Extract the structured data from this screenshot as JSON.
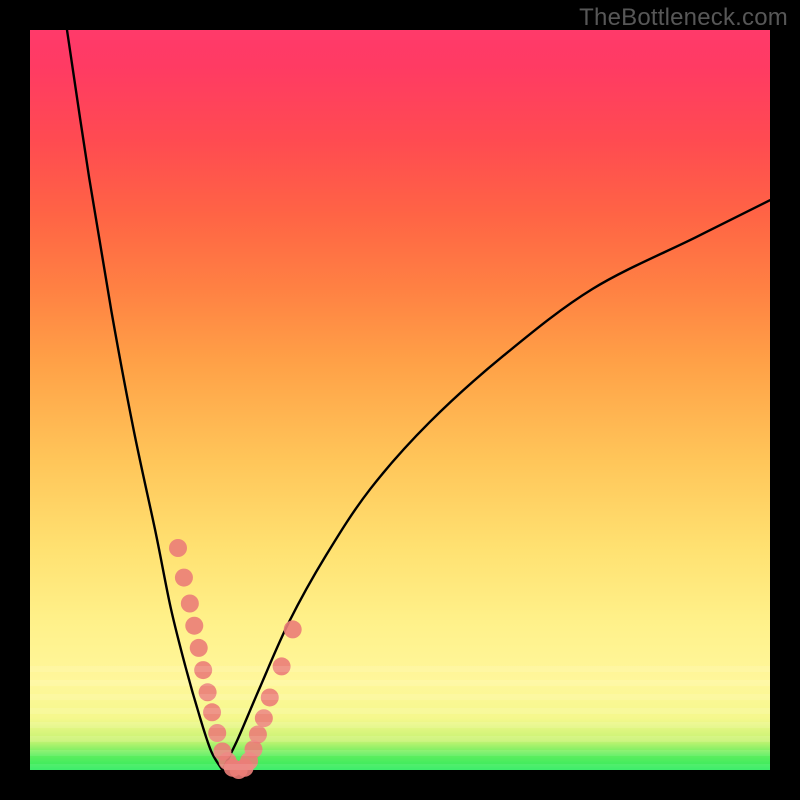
{
  "watermark": {
    "text": "TheBottleneck.com"
  },
  "chart_data": {
    "type": "line",
    "title": "",
    "xlabel": "",
    "ylabel": "",
    "xlim": [
      0,
      100
    ],
    "ylim": [
      0,
      100
    ],
    "minimum_x": 26,
    "series": [
      {
        "name": "bottleneck-curve-left",
        "x": [
          5,
          8,
          11,
          14,
          17,
          19,
          21,
          23,
          24.5,
          26
        ],
        "values": [
          100,
          80,
          62,
          46,
          32,
          22,
          14,
          7,
          2.5,
          0
        ]
      },
      {
        "name": "bottleneck-curve-right",
        "x": [
          26,
          28,
          31,
          35,
          40,
          46,
          54,
          64,
          76,
          90,
          100
        ],
        "values": [
          0,
          4,
          11,
          20,
          29,
          38,
          47,
          56,
          65,
          72,
          77
        ]
      }
    ],
    "scatter": {
      "name": "data-points",
      "color": "#eb7d78",
      "x": [
        20,
        20.8,
        21.6,
        22.2,
        22.8,
        23.4,
        24.0,
        24.6,
        25.3,
        26.0,
        26.7,
        27.4,
        28.2,
        29.0,
        29.6,
        30.2,
        30.8,
        31.6,
        32.4,
        34.0,
        35.5
      ],
      "values": [
        30,
        26,
        22.5,
        19.5,
        16.5,
        13.5,
        10.5,
        7.8,
        5.0,
        2.5,
        1.2,
        0.3,
        0.0,
        0.3,
        1.2,
        2.8,
        4.8,
        7.0,
        9.8,
        14.0,
        19.0
      ]
    },
    "gradient_stops": [
      {
        "pos": 0,
        "color": "#2eeb5d"
      },
      {
        "pos": 10,
        "color": "#fff79b"
      },
      {
        "pos": 50,
        "color": "#ffb24e"
      },
      {
        "pos": 100,
        "color": "#ff3a6a"
      }
    ]
  }
}
